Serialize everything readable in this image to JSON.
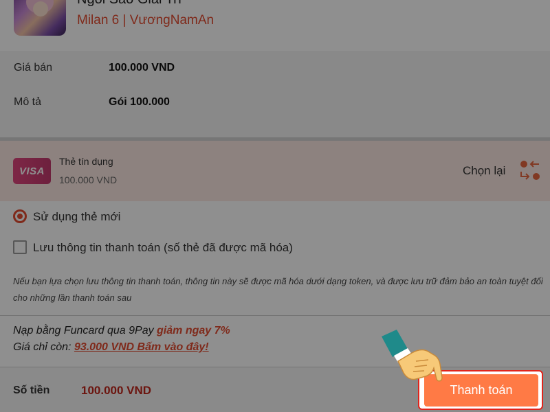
{
  "game": {
    "name": "Ngôi Sao Giải Trí",
    "server": "Milan 6 | VươngNamAn"
  },
  "order": {
    "price_label": "Giá bán",
    "price_value": "100.000 VND",
    "desc_label": "Mô tả",
    "desc_value": "Gói 100.000"
  },
  "payment_method": {
    "card_brand": "VISA",
    "name": "Thẻ tín dụng",
    "amount": "100.000 VND",
    "change_label": "Chọn lại",
    "change_icon": "swap-icon"
  },
  "options": {
    "new_card_label": "Sử dụng thẻ mới",
    "new_card_selected": true,
    "save_info_label": "Lưu thông tin thanh toán (số thẻ đã được mã hóa)",
    "save_info_checked": false
  },
  "note": "Nếu bạn lựa chọn lưu thông tin thanh toán, thông tin này sẽ được mã hóa dưới dạng token, và được lưu trữ đảm bảo an toàn tuyệt đối cho những lần thanh toán sau",
  "promo": {
    "line1_text": "Nạp bằng Funcard qua 9Pay ",
    "line1_highlight": "giảm ngay 7%",
    "line2_text": "Giá chỉ còn: ",
    "line2_link": "93.000 VND Bấm vào đây!"
  },
  "footer": {
    "total_label": "Số tiền",
    "total_value": "100.000 VND",
    "pay_button": "Thanh toán"
  },
  "colors": {
    "accent": "#e34b30",
    "pay_button": "#ff7a45",
    "total": "#c0261c",
    "visa_gradient": "#e0457d",
    "pointer_hand": "#f7c978"
  }
}
